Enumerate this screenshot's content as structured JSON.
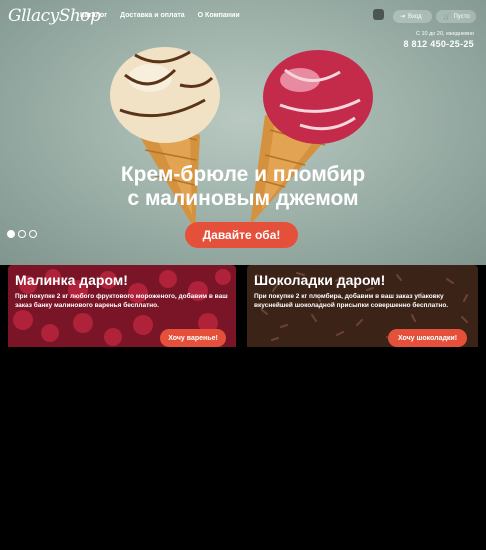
{
  "header": {
    "logo": "GllacyShop",
    "nav": [
      "Каталог",
      "Доставка и оплата",
      "О Компании"
    ],
    "login_label": "Вход",
    "cart_label": "Пусто",
    "hours": "С 10 до 20, ежедневно",
    "phone": "8 812 450-25-25"
  },
  "hero": {
    "line1": "Крем-брюле и пломбир",
    "line2": "с малиновым джемом",
    "cta": "Давайте оба!",
    "slides": 3,
    "active_slide": 1
  },
  "promos": [
    {
      "title": "Малинка даром!",
      "text": "При покупке 2 кг любого фруктового мороженого, добавим в ваш заказ банку малинового варенья бесплатно.",
      "button": "Хочу варенье!"
    },
    {
      "title": "Шоколадки даром!",
      "text": "При покупке 2 кг пломбира, добавим в ваш заказ упаковку вкуснейшей шоколадной присыпки совершенно бесплатно.",
      "button": "Хочу шоколадки!"
    }
  ],
  "colors": {
    "accent": "#e5503b",
    "hero_bg": "#9fb3ab"
  }
}
